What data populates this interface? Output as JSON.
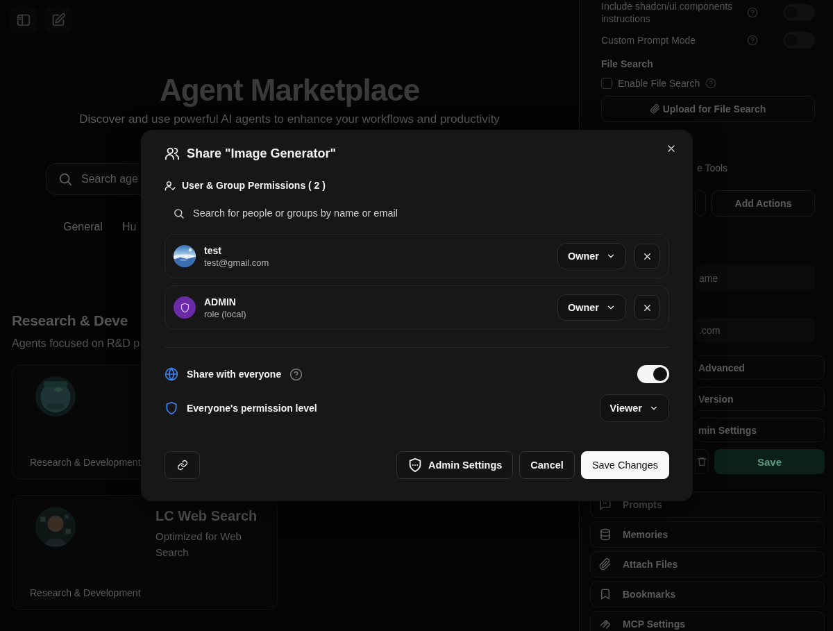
{
  "main": {
    "title": "Agent Marketplace",
    "subtitle": "Discover and use powerful AI agents to enhance your workflows and productivity",
    "search": {
      "placeholder": "Search age"
    },
    "tabs": [
      {
        "label": "General"
      },
      {
        "label": "Hu"
      }
    ],
    "section": {
      "title": "Research & Deve",
      "description": "Agents focused on R&D p"
    },
    "cards": [
      {
        "category": "Research & Development"
      },
      {
        "name": "LC Web Search",
        "description": "Optimized for Web Search",
        "category": "Research & Development"
      }
    ]
  },
  "side_panel": {
    "toggles": [
      {
        "label": "Include shadcn/ui components instructions",
        "on": false
      },
      {
        "label": "Custom Prompt Mode",
        "on": false
      }
    ],
    "file_search": {
      "heading": "File Search",
      "checkbox": {
        "label": "Enable File Search",
        "checked": false
      },
      "upload_button": "Upload for File Search"
    },
    "tools_label": "e Tools",
    "actions_button": "Add Actions",
    "fields": [
      {
        "text": "ame"
      },
      {
        "text": ".com"
      }
    ],
    "buttons": [
      "Advanced",
      "Version",
      "min Settings"
    ],
    "save_button": "Save",
    "nav": [
      {
        "kind": "prompts",
        "label": "Prompts"
      },
      {
        "kind": "memories",
        "label": "Memories"
      },
      {
        "kind": "attach",
        "label": "Attach Files"
      },
      {
        "kind": "bookmarks",
        "label": "Bookmarks"
      },
      {
        "kind": "mcp",
        "label": "MCP Settings"
      }
    ]
  },
  "dialog": {
    "title": "Share \"Image Generator\"",
    "permissions_heading": "User & Group Permissions ( 2 )",
    "search": {
      "placeholder": "Search for people or groups by name or email"
    },
    "members": [
      {
        "kind": "user",
        "name": "test",
        "detail": "test@gmail.com",
        "permission": "Owner"
      },
      {
        "kind": "role",
        "name": "ADMIN",
        "detail": "role (local)",
        "permission": "Owner"
      }
    ],
    "share_everyone": {
      "label": "Share with everyone",
      "on": true
    },
    "everyone_permission": {
      "label": "Everyone's permission level",
      "value": "Viewer"
    },
    "buttons": {
      "admin": "Admin Settings",
      "cancel": "Cancel",
      "save": "Save Changes"
    }
  }
}
